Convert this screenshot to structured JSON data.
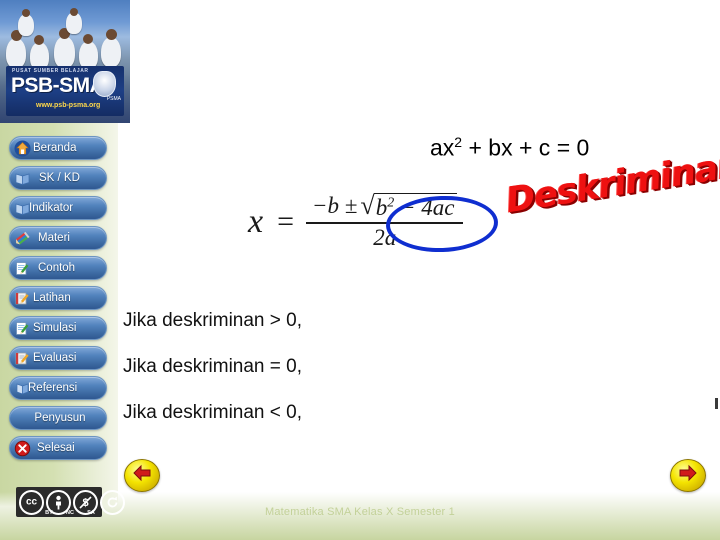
{
  "logo": {
    "tagline": "PUSAT SUMBER BELAJAR",
    "title": "PSB-SMA",
    "url": "www.psb-psma.org",
    "seal_sub": "PSMA"
  },
  "sidebar": {
    "items": [
      {
        "label": "Beranda",
        "icon": "home-icon"
      },
      {
        "label": "SK / KD",
        "icon": "book-blue-icon"
      },
      {
        "label": "Indikator",
        "icon": "book-blue-icon"
      },
      {
        "label": "Materi",
        "icon": "pencils-icon"
      },
      {
        "label": "Contoh",
        "icon": "note-pencil-icon"
      },
      {
        "label": "Latihan",
        "icon": "notebook-pencil-icon"
      },
      {
        "label": "Simulasi",
        "icon": "note-pencil-icon"
      },
      {
        "label": "Evaluasi",
        "icon": "notebook-pencil-icon"
      },
      {
        "label": "Referensi",
        "icon": "book-blue-icon"
      },
      {
        "label": "Penyusun",
        "icon": "none"
      },
      {
        "label": "Selesai",
        "icon": "close-red-icon"
      }
    ]
  },
  "main": {
    "equation_top": "ax2 + bx + c = 0",
    "equation_top_base": "ax",
    "equation_top_exp": "2",
    "equation_top_rest": " + bx + c = 0",
    "formula": {
      "lhs": "x",
      "equals": "=",
      "numerator_prefix": "−b ±",
      "radicand_b": "b",
      "radicand_b_exp": "2",
      "radicand_rest": "− 4ac",
      "denominator": "2a"
    },
    "annotation_label": "Deskriminan",
    "lines": [
      "Jika deskriminan > 0,",
      "Jika deskriminan = 0,",
      "Jika deskriminan < 0,"
    ]
  },
  "nav": {
    "prev_label": "prev-arrow-icon",
    "next_label": "next-arrow-icon"
  },
  "license": {
    "mark": "cc",
    "terms": [
      "BY",
      "NC",
      "SA"
    ]
  },
  "footer": {
    "text": "Matematika SMA Kelas X Semester 1"
  },
  "colors": {
    "annotation_red": "#ee1111",
    "ellipse_blue": "#0f2ed0",
    "menu_blue": "#3a679f",
    "band_green": "#c7d5a0",
    "nav_yellow": "#f4e400"
  }
}
